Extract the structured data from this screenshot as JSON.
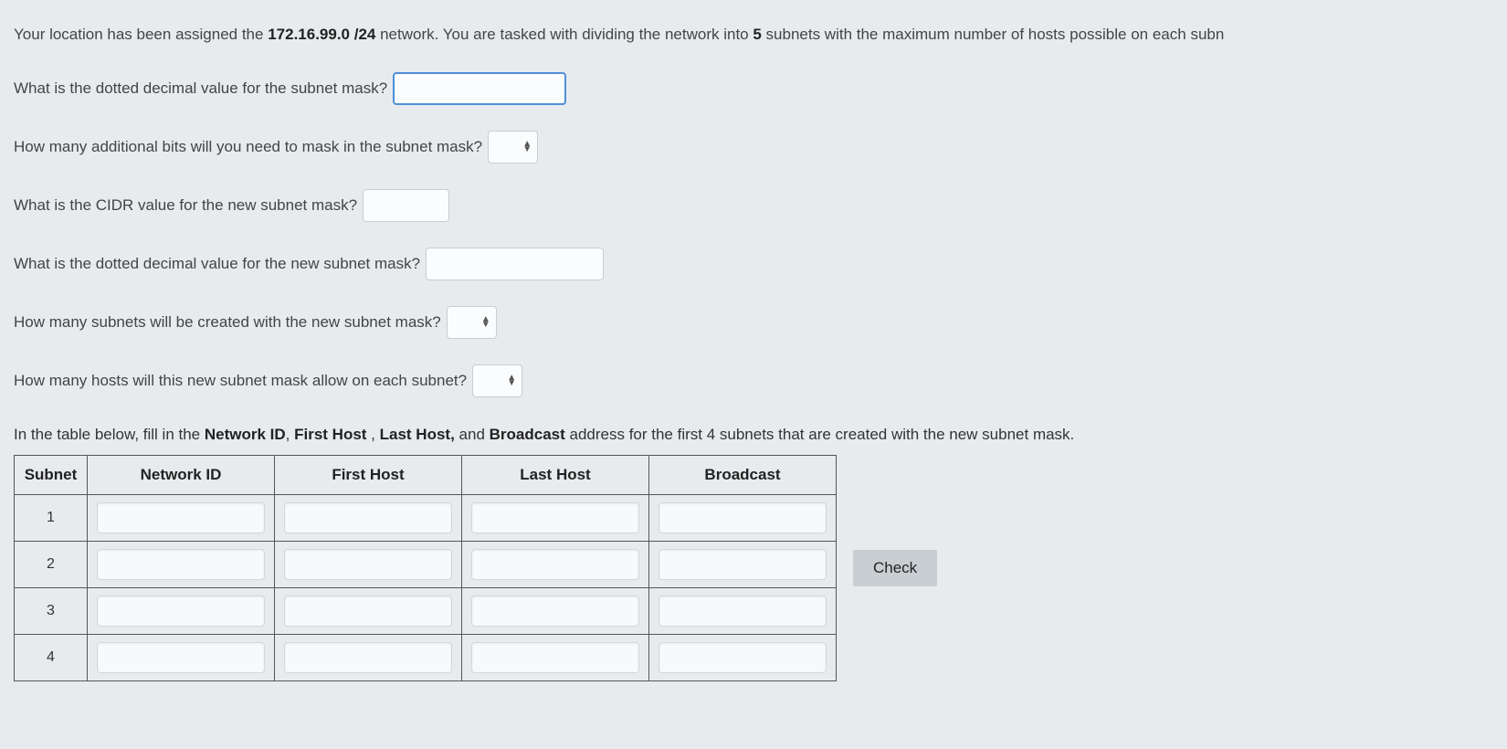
{
  "intro": {
    "prefix": "Your location has been assigned the ",
    "network": "172.16.99.0 /24",
    "middle": " network. You are tasked with dividing the network into ",
    "subnet_count": "5",
    "suffix": " subnets with the maximum number of hosts possible on each subn"
  },
  "questions": {
    "q1_label": "What is the dotted decimal value for the subnet mask?",
    "q1_value": "",
    "q2_label": "How many additional bits will you need to mask in the subnet mask?",
    "q2_value": "",
    "q3_label": "What is the CIDR value for the new subnet mask?",
    "q3_value": "",
    "q4_label": "What is the dotted decimal value for the new subnet mask?",
    "q4_value": "",
    "q5_label": "How many subnets will be created with the new subnet mask?",
    "q5_value": "",
    "q6_label": "How many hosts will this new subnet mask allow on each subnet?",
    "q6_value": ""
  },
  "table_instruction": {
    "prefix": "In the table below, fill in the ",
    "b1": "Network ID",
    "sep1": ", ",
    "b2": "First Host",
    "sep2": " , ",
    "b3": "Last Host,",
    "sep3": " and ",
    "b4": "Broadcast",
    "suffix": " address for the first 4 subnets that are created with the new subnet mask."
  },
  "table": {
    "headers": {
      "subnet": "Subnet",
      "network_id": "Network ID",
      "first_host": "First Host",
      "last_host": "Last Host",
      "broadcast": "Broadcast"
    },
    "rows": [
      {
        "label": "1",
        "network_id": "",
        "first_host": "",
        "last_host": "",
        "broadcast": ""
      },
      {
        "label": "2",
        "network_id": "",
        "first_host": "",
        "last_host": "",
        "broadcast": ""
      },
      {
        "label": "3",
        "network_id": "",
        "first_host": "",
        "last_host": "",
        "broadcast": ""
      },
      {
        "label": "4",
        "network_id": "",
        "first_host": "",
        "last_host": "",
        "broadcast": ""
      }
    ]
  },
  "buttons": {
    "check": "Check"
  }
}
